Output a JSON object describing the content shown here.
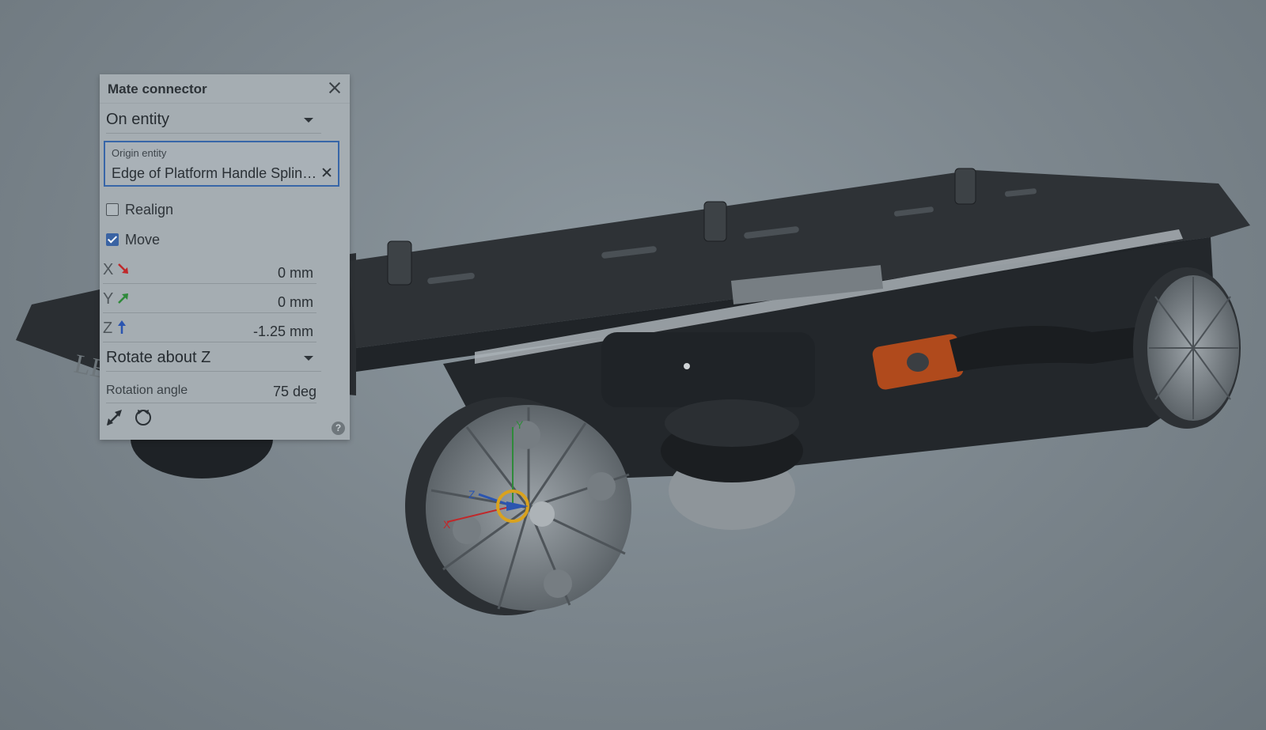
{
  "panel": {
    "title": "Mate connector",
    "mode_dropdown": "On entity",
    "origin_entity": {
      "caption": "Origin entity",
      "value": "Edge of Platform Handle Splin…"
    },
    "realign": {
      "label": "Realign",
      "checked": false
    },
    "move": {
      "label": "Move",
      "checked": true
    },
    "offsets": [
      {
        "axis": "X",
        "value": "0 mm",
        "arrow_color": "#c0282a",
        "icon": "arrow-down-right-icon"
      },
      {
        "axis": "Y",
        "value": "0 mm",
        "arrow_color": "#2f8a3a",
        "icon": "arrow-up-right-icon"
      },
      {
        "axis": "Z",
        "value": "-1.25 mm",
        "arrow_color": "#2b55b0",
        "icon": "arrow-up-icon"
      }
    ],
    "rotate_dropdown": "Rotate about Z",
    "rotation_angle": {
      "label": "Rotation angle",
      "value": "75 deg"
    },
    "tools": [
      "flip-primary-axis-icon",
      "reorient-secondary-axis-icon"
    ],
    "help_icon": "?"
  },
  "viewport": {
    "model_engraving": "LEN",
    "triad_labels": {
      "x": "X",
      "y": "Y",
      "z": "Z"
    },
    "colors": {
      "background": "#7c868d",
      "model_body": "#262a2e",
      "accent_orange": "#c4531f",
      "selection_ring": "#d9a21e"
    }
  }
}
